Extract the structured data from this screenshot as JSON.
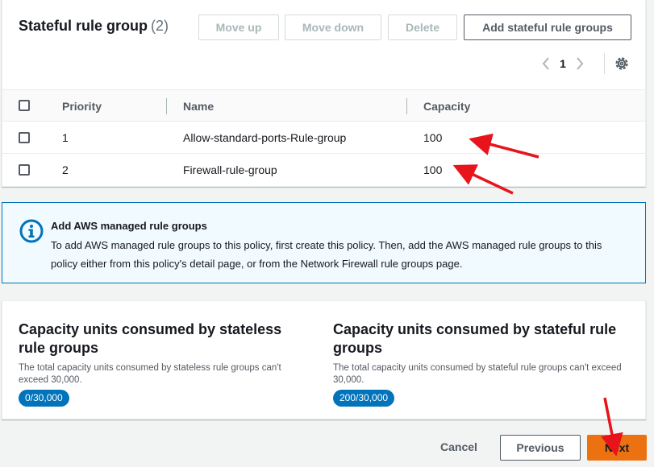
{
  "stateful": {
    "title": "Stateful rule group",
    "count": "(2)",
    "buttons": {
      "move_up": "Move up",
      "move_down": "Move down",
      "delete": "Delete",
      "add": "Add stateful rule groups"
    },
    "pagination": {
      "current_page": "1",
      "prev_icon": "chevron-left-icon",
      "next_icon": "chevron-right-icon"
    },
    "settings_icon": "gear-icon",
    "columns": [
      "Priority",
      "Name",
      "Capacity"
    ],
    "rows": [
      {
        "priority": "1",
        "name": "Allow-standard-ports-Rule-group",
        "capacity": "100"
      },
      {
        "priority": "2",
        "name": "Firewall-rule-group",
        "capacity": "100"
      }
    ]
  },
  "info_alert": {
    "icon": "info-icon",
    "title": "Add AWS managed rule groups",
    "body": "To add AWS managed rule groups to this policy, first create this policy. Then, add the AWS managed rule groups to this policy either from this policy's detail page, or from the Network Firewall rule groups page."
  },
  "capacity": {
    "stateless": {
      "title": "Capacity units consumed by stateless rule groups",
      "description": "The total capacity units consumed by stateless rule groups can't exceed 30,000.",
      "badge": "0/30,000"
    },
    "stateful": {
      "title": "Capacity units consumed by stateful rule groups",
      "description": "The total capacity units consumed by stateful rule groups can't exceed 30,000.",
      "badge": "200/30,000"
    }
  },
  "footer": {
    "cancel": "Cancel",
    "previous": "Previous",
    "next": "Next"
  },
  "colors": {
    "primary_button": "#ec7211",
    "info_border": "#0073bb",
    "badge": "#0073bb",
    "annotation_arrow": "#e8141b"
  }
}
